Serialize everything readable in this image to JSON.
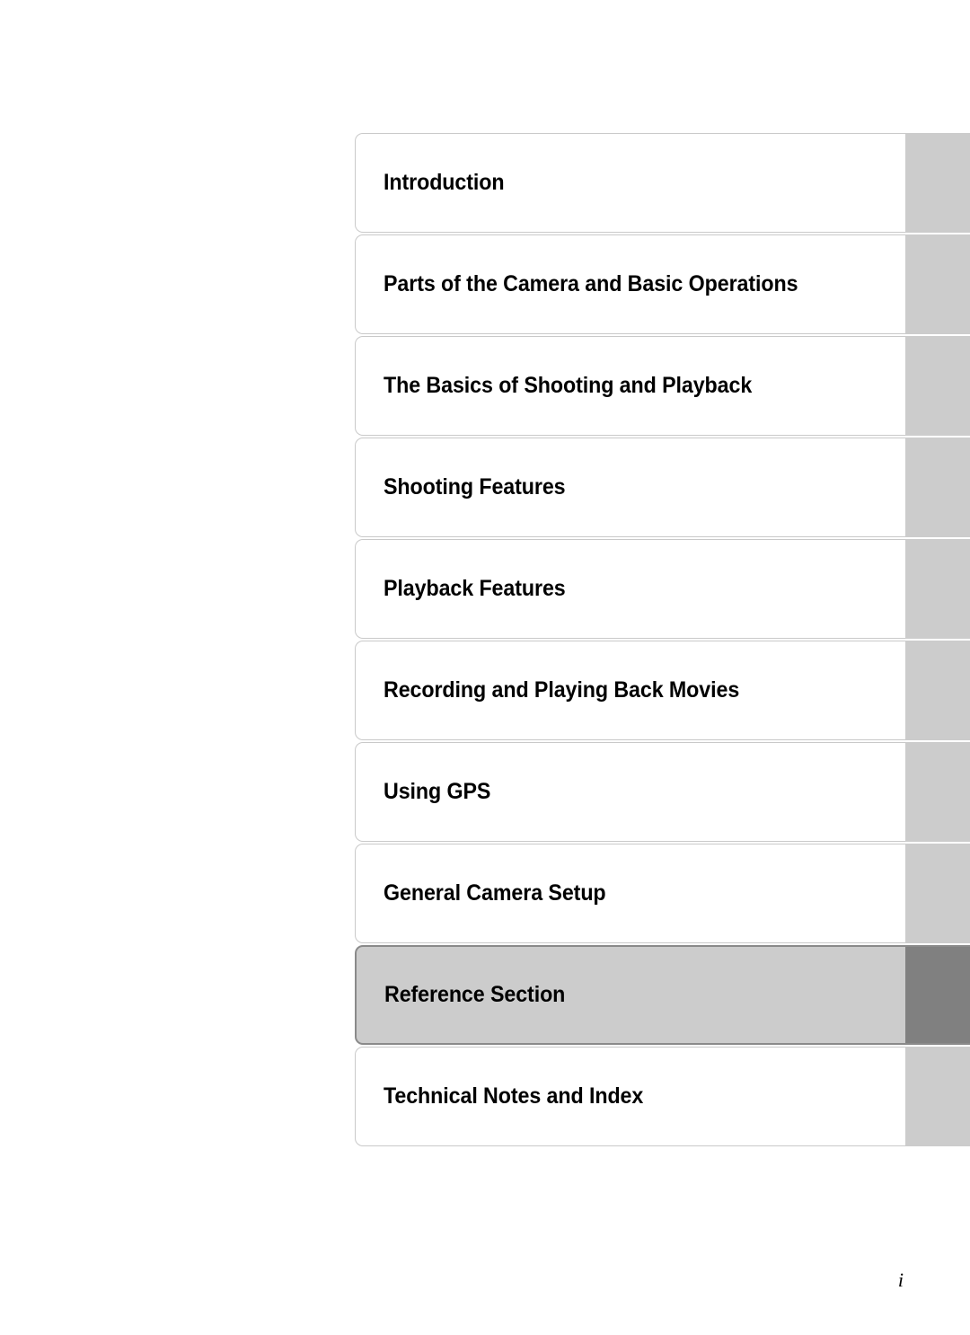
{
  "document": {
    "page_number": "i"
  },
  "chapter_index": {
    "active_index": 8,
    "colors": {
      "tab_body_inactive": "#ffffff",
      "tab_edge_inactive": "#cccccc",
      "tab_body_active": "#cccccc",
      "tab_edge_active": "#808080",
      "tab_border_inactive": "#c9c9c9",
      "tab_border_active": "#8a8a8a",
      "label": "#000000"
    },
    "tabs": [
      {
        "label": "Introduction",
        "active": false
      },
      {
        "label": "Parts of the Camera and Basic Operations",
        "active": false
      },
      {
        "label": "The Basics of Shooting and Playback",
        "active": false
      },
      {
        "label": "Shooting Features",
        "active": false
      },
      {
        "label": "Playback Features",
        "active": false
      },
      {
        "label": "Recording and Playing Back Movies",
        "active": false
      },
      {
        "label": "Using GPS",
        "active": false
      },
      {
        "label": "General Camera Setup",
        "active": false
      },
      {
        "label": "Reference Section",
        "active": true
      },
      {
        "label": "Technical Notes and Index",
        "active": false
      }
    ]
  }
}
